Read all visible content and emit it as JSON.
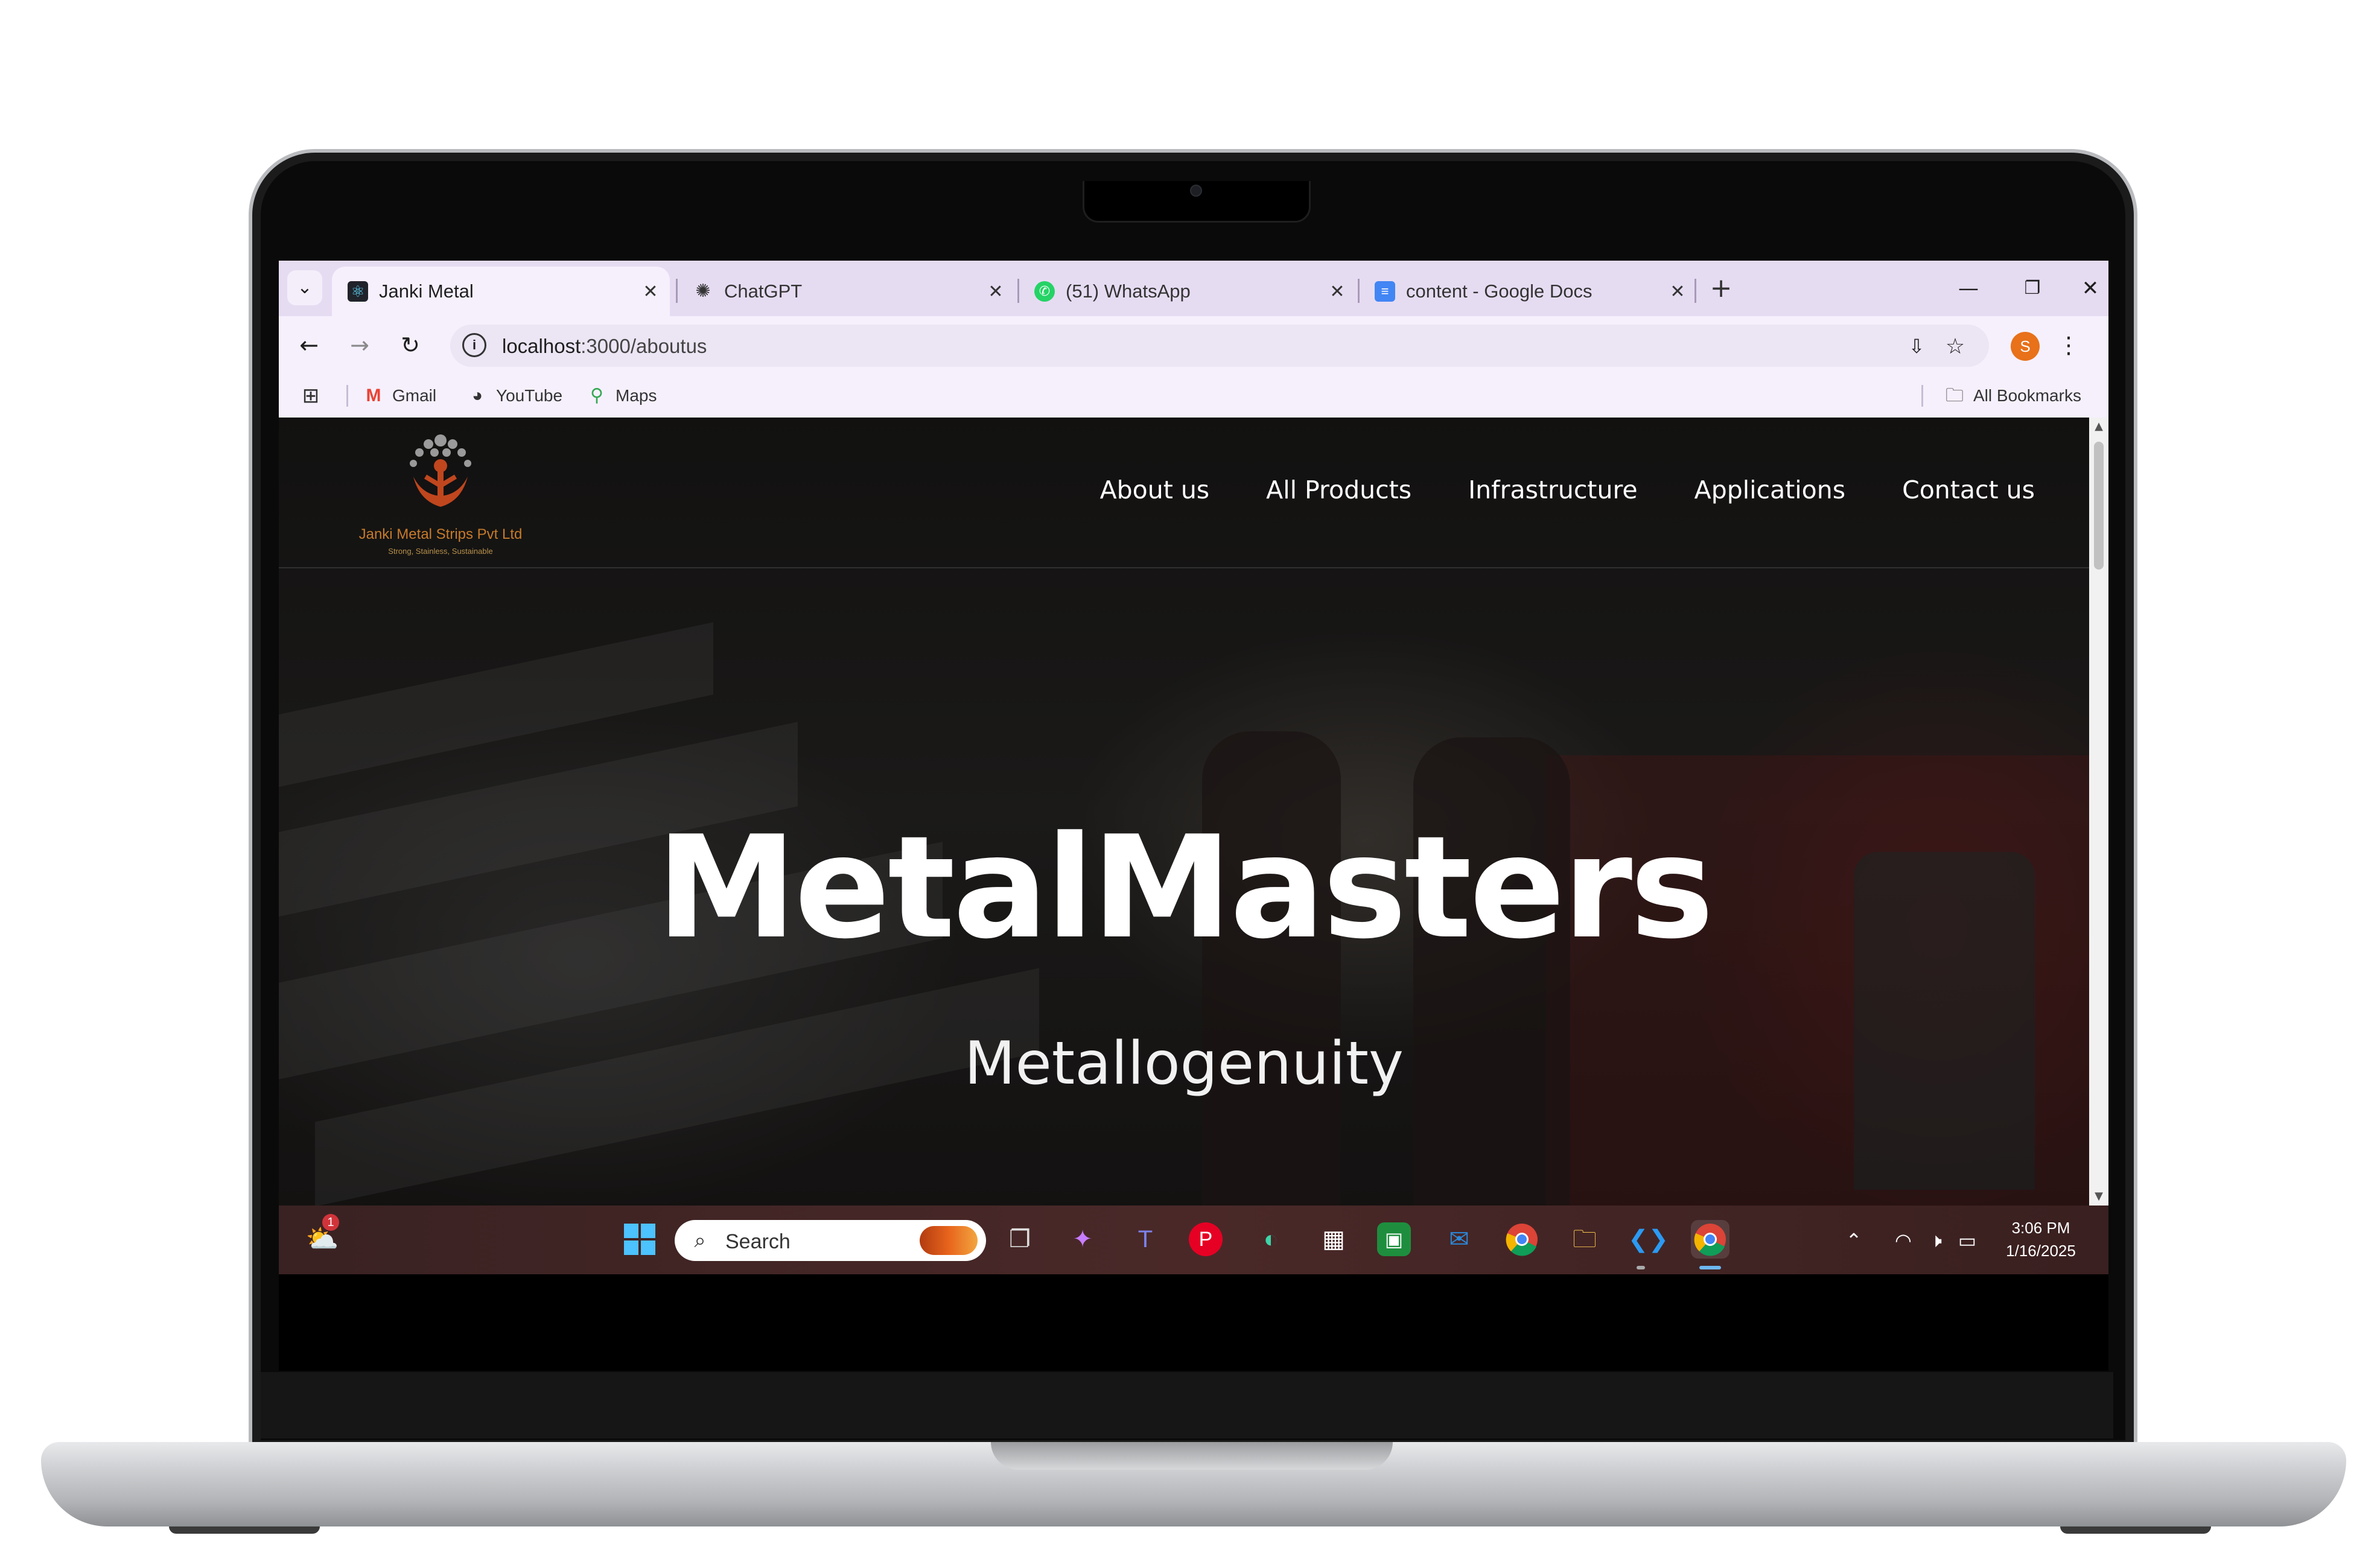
{
  "browser": {
    "tabs": [
      {
        "title": "Janki Metal",
        "active": true,
        "favicon": "react-icon"
      },
      {
        "title": "ChatGPT",
        "active": false,
        "favicon": "chatgpt-icon"
      },
      {
        "title": "(51) WhatsApp",
        "active": false,
        "favicon": "whatsapp-icon"
      },
      {
        "title": "content - Google Docs",
        "active": false,
        "favicon": "google-docs-icon"
      }
    ],
    "address": {
      "host": "localhost",
      "path": ":3000/aboutus"
    },
    "profile_initial": "S",
    "bookmarks": [
      {
        "label": "Gmail",
        "icon": "gmail-icon"
      },
      {
        "label": "YouTube",
        "icon": "globe-icon"
      },
      {
        "label": "Maps",
        "icon": "maps-pin-icon"
      }
    ],
    "all_bookmarks_label": "All Bookmarks"
  },
  "site": {
    "logo": {
      "name": "Janki Metal Strips Pvt Ltd",
      "tagline": "Strong, Stainless, Sustainable"
    },
    "nav": [
      "About us",
      "All Products",
      "Infrastructure",
      "Applications",
      "Contact us"
    ],
    "hero": {
      "title": "MetalMasters",
      "subtitle": "Metallogenuity"
    }
  },
  "taskbar": {
    "search_label": "Search",
    "weather_badge": "1",
    "time": "3:06 PM",
    "date": "1/16/2025",
    "accent": "#6cb8f0"
  },
  "colors": {
    "tabstrip": "#e6dcf2",
    "toolbar": "#f6f0fd",
    "logo_accent": "#c77a2a"
  }
}
